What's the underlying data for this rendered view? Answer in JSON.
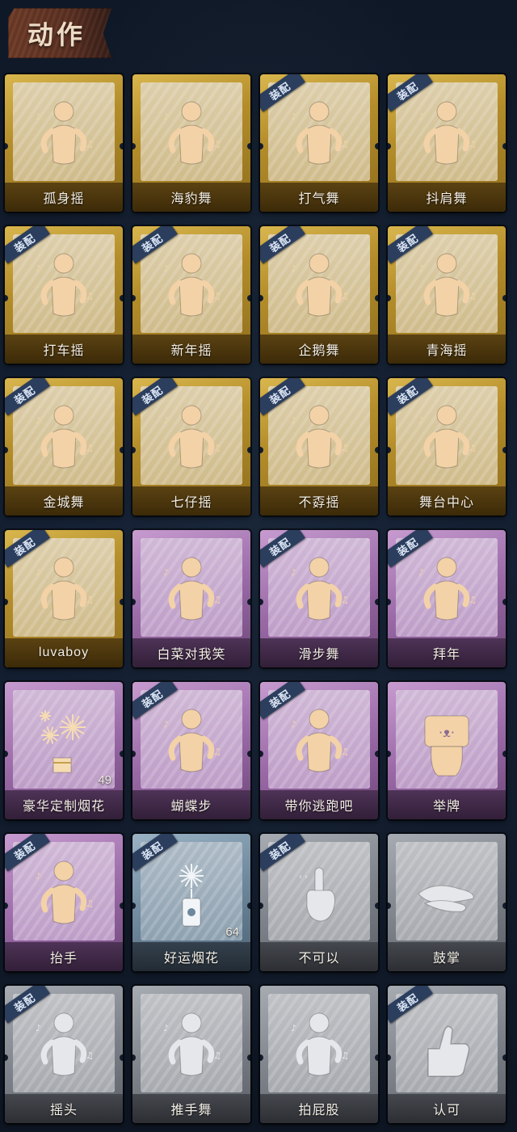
{
  "header": {
    "title": "动作"
  },
  "equip_badge": "装配",
  "cards": [
    {
      "label": "孤身摇",
      "tier": "gold",
      "equipped": false,
      "icon": "dance-figure-icon"
    },
    {
      "label": "海豹舞",
      "tier": "gold",
      "equipped": false,
      "icon": "dance-figure-icon"
    },
    {
      "label": "打气舞",
      "tier": "gold",
      "equipped": true,
      "icon": "dance-figure-icon"
    },
    {
      "label": "抖肩舞",
      "tier": "gold",
      "equipped": true,
      "icon": "dance-figure-icon"
    },
    {
      "label": "打车摇",
      "tier": "gold",
      "equipped": true,
      "icon": "dance-figure-icon"
    },
    {
      "label": "新年摇",
      "tier": "gold",
      "equipped": true,
      "icon": "dance-figure-icon"
    },
    {
      "label": "企鹅舞",
      "tier": "gold",
      "equipped": true,
      "icon": "dance-figure-icon"
    },
    {
      "label": "青海摇",
      "tier": "gold",
      "equipped": true,
      "icon": "dance-figure-icon"
    },
    {
      "label": "金城舞",
      "tier": "gold",
      "equipped": true,
      "icon": "dance-figure-icon"
    },
    {
      "label": "七仔摇",
      "tier": "gold",
      "equipped": true,
      "icon": "dance-figure-icon"
    },
    {
      "label": "不孬摇",
      "tier": "gold",
      "equipped": true,
      "icon": "dance-figure-icon"
    },
    {
      "label": "舞台中心",
      "tier": "gold",
      "equipped": true,
      "icon": "dance-figure-icon"
    },
    {
      "label": "luvaboy",
      "tier": "gold",
      "equipped": true,
      "icon": "dance-figure-icon"
    },
    {
      "label": "白菜对我笑",
      "tier": "purple",
      "equipped": false,
      "icon": "dance-figure-icon"
    },
    {
      "label": "滑步舞",
      "tier": "purple",
      "equipped": true,
      "icon": "dance-figure-icon"
    },
    {
      "label": "拜年",
      "tier": "purple",
      "equipped": true,
      "icon": "bow-figure-icon"
    },
    {
      "label": "豪华定制烟花",
      "tier": "purple",
      "equipped": false,
      "icon": "fireworks-icon",
      "count": "49"
    },
    {
      "label": "蝴蝶步",
      "tier": "purple",
      "equipped": true,
      "icon": "dance-figure-icon"
    },
    {
      "label": "带你逃跑吧",
      "tier": "purple",
      "equipped": true,
      "icon": "dance-figure-icon"
    },
    {
      "label": "举牌",
      "tier": "purple",
      "equipped": false,
      "icon": "sign-holding-icon"
    },
    {
      "label": "抬手",
      "tier": "purple",
      "equipped": true,
      "icon": "raise-hand-icon"
    },
    {
      "label": "好运烟花",
      "tier": "blue",
      "equipped": true,
      "icon": "firework-can-icon",
      "count": "64"
    },
    {
      "label": "不可以",
      "tier": "gray",
      "equipped": true,
      "icon": "finger-wag-icon"
    },
    {
      "label": "鼓掌",
      "tier": "gray",
      "equipped": false,
      "icon": "clap-icon"
    },
    {
      "label": "摇头",
      "tier": "gray",
      "equipped": true,
      "icon": "head-shake-icon"
    },
    {
      "label": "推手舞",
      "tier": "gray",
      "equipped": false,
      "icon": "push-hand-icon"
    },
    {
      "label": "拍屁股",
      "tier": "gray",
      "equipped": false,
      "icon": "pat-icon"
    },
    {
      "label": "认可",
      "tier": "gray",
      "equipped": true,
      "icon": "thumbs-up-icon"
    }
  ]
}
